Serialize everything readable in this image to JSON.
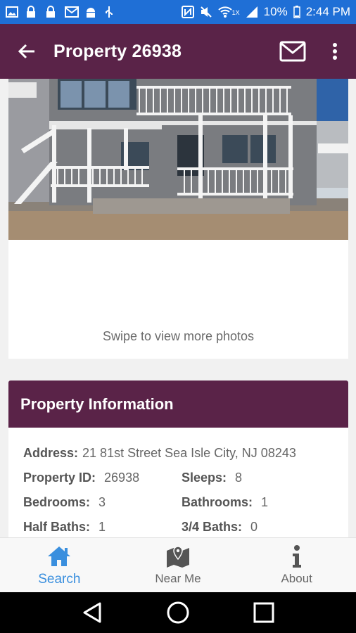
{
  "status_bar": {
    "battery_text": "10%",
    "time": "2:44 PM",
    "network_label": "1X",
    "icons": [
      "image-icon",
      "lock-icon",
      "lock-icon",
      "mail-icon",
      "android-icon",
      "usb-icon",
      "nfc-icon",
      "mute-icon",
      "wifi-icon",
      "signal-icon",
      "battery-icon"
    ]
  },
  "app_bar": {
    "title": "Property 26938",
    "icons": [
      "back-arrow-icon",
      "mail-icon",
      "more-vert-icon"
    ]
  },
  "photo_card": {
    "swipe_hint": "Swipe to view more photos"
  },
  "property_info": {
    "header": "Property Information",
    "address_label": "Address:",
    "address_value": "21 81st Street Sea Isle City, NJ 08243",
    "property_id_label": "Property ID:",
    "property_id_value": "26938",
    "sleeps_label": "Sleeps:",
    "sleeps_value": "8",
    "bedrooms_label": "Bedrooms:",
    "bedrooms_value": "3",
    "bathrooms_label": "Bathrooms:",
    "bathrooms_value": "1",
    "half_baths_label": "Half Baths:",
    "half_baths_value": "1",
    "three_quarter_baths_label": "3/4 Baths:",
    "three_quarter_baths_value": "0"
  },
  "bottom_nav": {
    "items": [
      {
        "label": "Search",
        "icon": "home-icon",
        "active": true
      },
      {
        "label": "Near Me",
        "icon": "map-pin-icon",
        "active": false
      },
      {
        "label": "About",
        "icon": "info-icon",
        "active": false
      }
    ]
  },
  "colors": {
    "status_bar": "#1f6fd6",
    "brand": "#5a2348",
    "active_nav": "#3a8fde",
    "background": "#f1f1f1"
  }
}
